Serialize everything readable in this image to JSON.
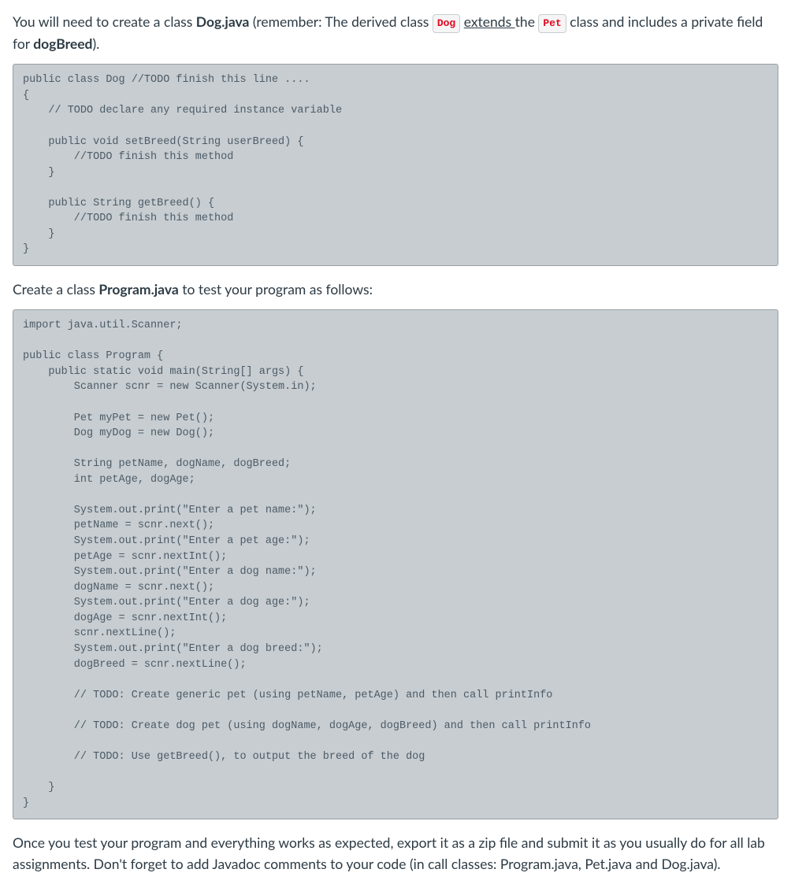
{
  "para1": {
    "pre_text": "You will need to create a class ",
    "class_name": "Dog.java",
    "after_class": " (remember: The derived class ",
    "badge1": "Dog",
    "space1": " ",
    "underlined": "extends ",
    "after_underline": "the ",
    "badge2": "Pet",
    "rest": " class and includes a private field for ",
    "bold_end": "dogBreed",
    "closing": ")."
  },
  "code1": "public class Dog //TODO finish this line ....\n{\n    // TODO declare any required instance variable\n\n    public void setBreed(String userBreed) {\n        //TODO finish this method\n    }\n\n    public String getBreed() {\n        //TODO finish this method\n    }\n}",
  "para2": {
    "pre_text": "Create a class ",
    "bold": "Program.java",
    "post_text": " to test your program as follows:"
  },
  "code2": "import java.util.Scanner;\n\npublic class Program {\n    public static void main(String[] args) {\n        Scanner scnr = new Scanner(System.in);\n\n        Pet myPet = new Pet();\n        Dog myDog = new Dog();\n\n        String petName, dogName, dogBreed;\n        int petAge, dogAge;\n\n        System.out.print(\"Enter a pet name:\");\n        petName = scnr.next();\n        System.out.print(\"Enter a pet age:\");\n        petAge = scnr.nextInt();\n        System.out.print(\"Enter a dog name:\");\n        dogName = scnr.next();\n        System.out.print(\"Enter a dog age:\");\n        dogAge = scnr.nextInt();\n        scnr.nextLine();\n        System.out.print(\"Enter a dog breed:\");\n        dogBreed = scnr.nextLine();\n\n        // TODO: Create generic pet (using petName, petAge) and then call printInfo\n\n        // TODO: Create dog pet (using dogName, dogAge, dogBreed) and then call printInfo\n\n        // TODO: Use getBreed(), to output the breed of the dog\n\n    }\n}",
  "para3": "Once you test your program and everything works as expected, export it as a zip file and submit it as you usually do for all lab assignments. Don't forget to add Javadoc comments to your code (in call classes: Program.java, Pet.java and Dog.java)."
}
